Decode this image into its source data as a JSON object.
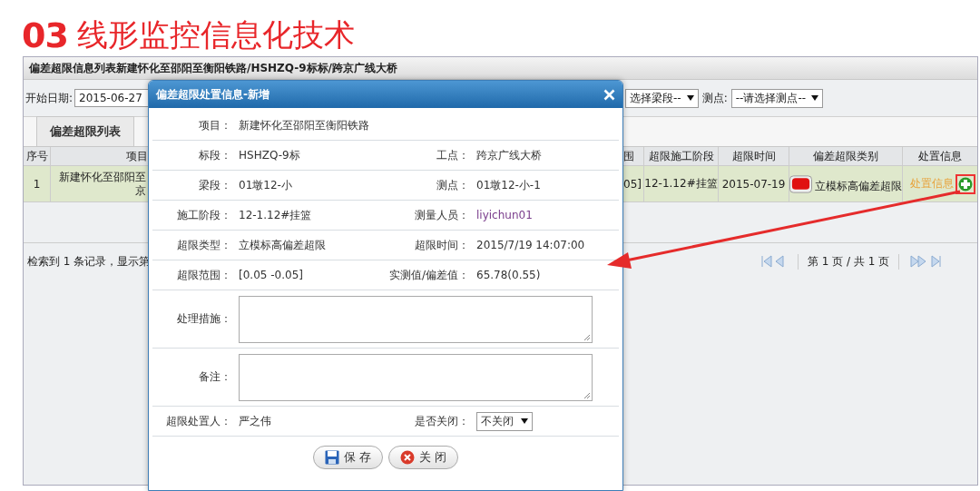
{
  "slide_title": {
    "number": "03",
    "text": "线形监控信息化技术"
  },
  "panel": {
    "title": "偏差超限信息列表新建怀化至邵阳至衡阳铁路/HSHZQ-9标标/跨京广线大桥",
    "filters": {
      "start_date_label": "开始日期:",
      "start_date": "2015-06-27",
      "segment_select": "选择梁段--",
      "point_label": "测点:",
      "point_select": "--请选择测点--"
    },
    "tabs": [
      {
        "label": "偏差超限列表",
        "selected": true
      }
    ],
    "table": {
      "columns": [
        "序号",
        "项目",
        "围",
        "超限施工阶段",
        "超限时间",
        "偏差超限类别",
        "处置信息"
      ],
      "rows": [
        {
          "selected": true,
          "cells": [
            "1",
            [
              "新建怀化至邵阳至",
              "京"
            ],
            "05]",
            "12-1.12#挂篮",
            "2015-07-19",
            "立模标高偏差超限",
            "处置信息"
          ]
        }
      ]
    },
    "footer": "检索到 1 条记录，显示第",
    "pager": "第 1 页 / 共 1 页"
  },
  "dialog": {
    "title": "偏差超限处置信息-新增",
    "rows": [
      {
        "kind": "full",
        "label": "项目：",
        "value": "新建怀化至邵阳至衡阳铁路"
      },
      {
        "kind": "pair",
        "items": [
          {
            "label": "标段：",
            "value": "HSHZQ-9标",
            "kind": "text"
          },
          {
            "label": "工点：",
            "value": "跨京广线大桥",
            "kind": "text"
          }
        ]
      },
      {
        "kind": "pair",
        "items": [
          {
            "label": "梁段：",
            "value": "01墩12-小",
            "kind": "text"
          },
          {
            "label": "测点：",
            "value": "01墩12-小-1",
            "kind": "text"
          }
        ]
      },
      {
        "kind": "pair",
        "items": [
          {
            "label": "施工阶段：",
            "value": "12-1.12#挂篮",
            "kind": "text"
          },
          {
            "label": "测量人员：",
            "value": "liyichun01",
            "kind": "user"
          }
        ]
      },
      {
        "kind": "pair",
        "items": [
          {
            "label": "超限类型：",
            "value": "立模标高偏差超限",
            "kind": "text"
          },
          {
            "label": "超限时间：",
            "value": "2015/7/19 14:07:00",
            "kind": "text"
          }
        ]
      },
      {
        "kind": "pair",
        "items": [
          {
            "label": "超限范围：",
            "value": "[0.05 -0.05]",
            "kind": "text"
          },
          {
            "label": "实测值/偏差值：",
            "value": "65.78(0.55)",
            "kind": "text"
          }
        ]
      },
      {
        "kind": "textarea",
        "label": "处理措施："
      },
      {
        "kind": "textarea",
        "label": "备注："
      },
      {
        "kind": "pair",
        "items": [
          {
            "label": "超限处置人：",
            "value": "严之伟",
            "kind": "text"
          },
          {
            "label": "是否关闭：",
            "value": "不关闭",
            "kind": "select"
          }
        ]
      }
    ],
    "buttons": [
      {
        "label": "保 存",
        "kind": "save"
      },
      {
        "label": "关 闭",
        "kind": "close"
      }
    ]
  }
}
